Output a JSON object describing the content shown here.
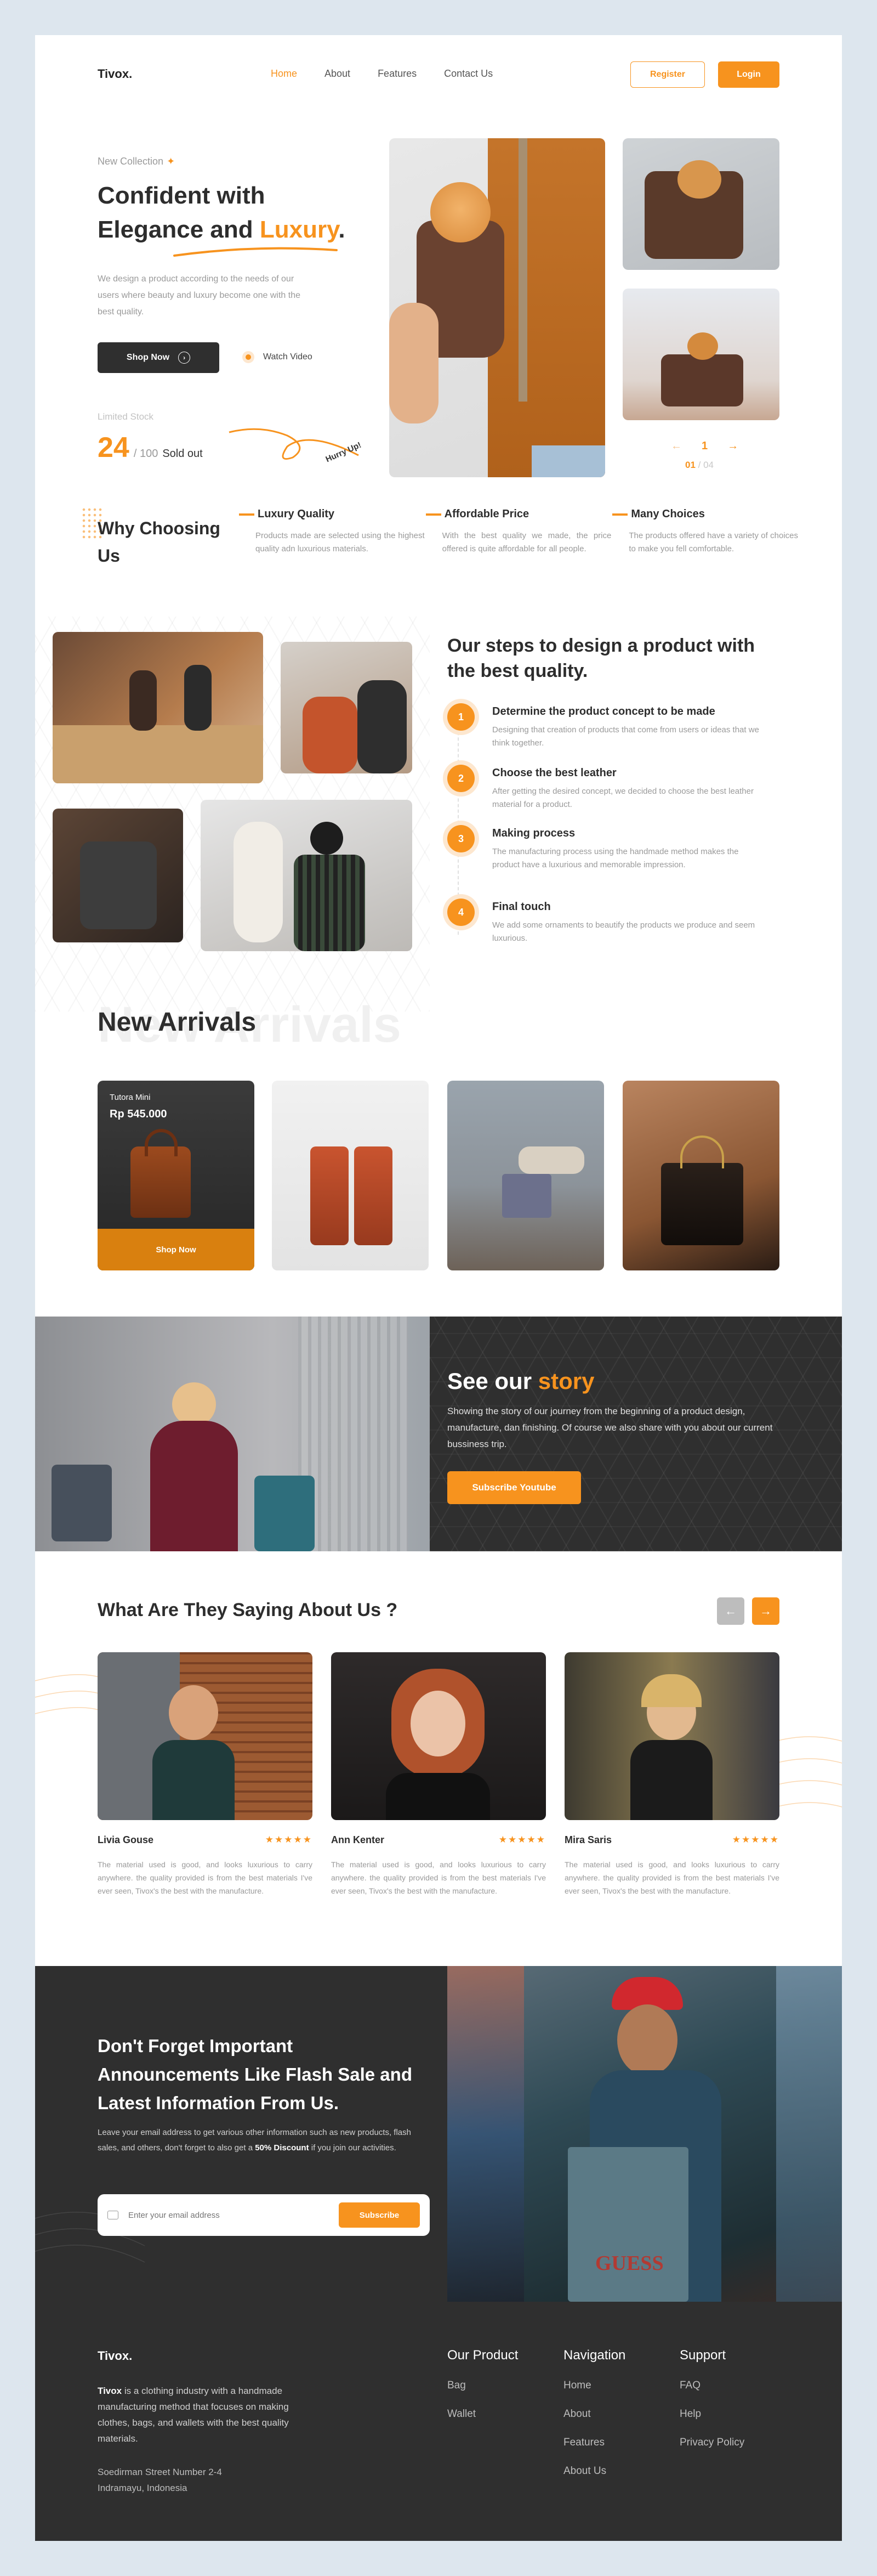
{
  "nav": {
    "logo": "Tivox.",
    "links": [
      "Home",
      "About",
      "Features",
      "Contact Us"
    ],
    "register": "Register",
    "login": "Login"
  },
  "hero": {
    "tag": "New Collection",
    "title_line1": "Confident with",
    "title_line2_a": "Elegance and ",
    "title_line2_b": "Luxury",
    "title_line2_c": ".",
    "desc": "We design a product according to the needs of our users where beauty and luxury become one with the best quality.",
    "shop_now": "Shop Now",
    "watch_video": "Watch Video",
    "stock_label": "Limited Stock",
    "stock_count": "24",
    "stock_total": "/ 100",
    "stock_sold": "Sold out",
    "hurry": "Hurry Up!",
    "pager_current": "1",
    "pager_text_a": "01",
    "pager_text_b": "/ 04"
  },
  "why": {
    "title": "Why Choosing Us",
    "items": [
      {
        "title": "Luxury Quality",
        "desc": "Products made are selected using the highest quality adn luxurious materials."
      },
      {
        "title": "Affordable Price",
        "desc": "With the best quality we made, the price offered is quite affordable for all people."
      },
      {
        "title": "Many Choices",
        "desc": "The products offered have a variety of choices to make you fell comfortable."
      }
    ]
  },
  "steps": {
    "title": "Our steps to design a product with the best quality.",
    "items": [
      {
        "num": "1",
        "title": "Determine the product concept to be made",
        "desc": "Designing that creation of products that come from users or ideas that we think together."
      },
      {
        "num": "2",
        "title": "Choose the best leather",
        "desc": "After getting the desired concept, we decided to choose the best leather material for a product."
      },
      {
        "num": "3",
        "title": "Making process",
        "desc": "The manufacturing process using the handmade method makes the product have a luxurious and memorable impression."
      },
      {
        "num": "4",
        "title": "Final touch",
        "desc": "We add some ornaments to beautify the products we produce and seem luxurious."
      }
    ]
  },
  "arrivals": {
    "title": "New Arrivals",
    "watermark": "New Arrivals",
    "featured_name": "Tutora Mini",
    "featured_price": "Rp 545.000",
    "shop_now": "Shop Now"
  },
  "story": {
    "title_a": "See our ",
    "title_b": "story",
    "desc": "Showing the story of our journey from the beginning of a product design, manufacture, dan finishing. Of course we also share with you about our current bussiness trip.",
    "button": "Subscribe Youtube"
  },
  "testimonials": {
    "title": "What Are They Saying About Us ?",
    "items": [
      {
        "name": "Livia Gouse",
        "stars": "★★★★★",
        "text": "The material used is good, and looks luxurious to carry anywhere. the quality provided is from the best materials I've ever seen, Tivox's the best with the manufacture."
      },
      {
        "name": "Ann Kenter",
        "stars": "★★★★★",
        "text": "The material used is good, and looks luxurious to carry anywhere. the quality provided is from the best materials I've ever seen, Tivox's the best with the manufacture."
      },
      {
        "name": "Mira Saris",
        "stars": "★★★★★",
        "text": "The material used is good, and looks luxurious to carry anywhere. the quality provided is from the best materials I've ever seen, Tivox's the best with the manufacture."
      }
    ]
  },
  "newsletter": {
    "title": "Don't Forget Important Announcements Like Flash Sale and Latest Information From Us.",
    "desc_a": "Leave your email address to get various other information such as new products, flash sales, and others, don't forget to also get a ",
    "desc_b": "50% Discount",
    "desc_c": " if you join our activities.",
    "placeholder": "Enter your email address",
    "button": "Subscribe",
    "bag_brand": "GUESS"
  },
  "footer": {
    "logo": "Tivox.",
    "desc_a": "Tivox",
    "desc_b": " is a clothing industry with a handmade manufacturing method that focuses on making clothes, bags, and wallets with the best quality materials.",
    "address_line1": "Soedirman Street Number 2-4",
    "address_line2": "Indramayu, Indonesia",
    "columns": [
      {
        "title": "Our Product",
        "links": [
          "Bag",
          "Wallet"
        ]
      },
      {
        "title": "Navigation",
        "links": [
          "Home",
          "About",
          "Features",
          "About Us"
        ]
      },
      {
        "title": "Support",
        "links": [
          "FAQ",
          "Help",
          "Privacy Policy"
        ]
      }
    ]
  },
  "colors": {
    "accent": "#f7931e",
    "dark": "#2f2f2f",
    "background": "#dde6ee"
  }
}
